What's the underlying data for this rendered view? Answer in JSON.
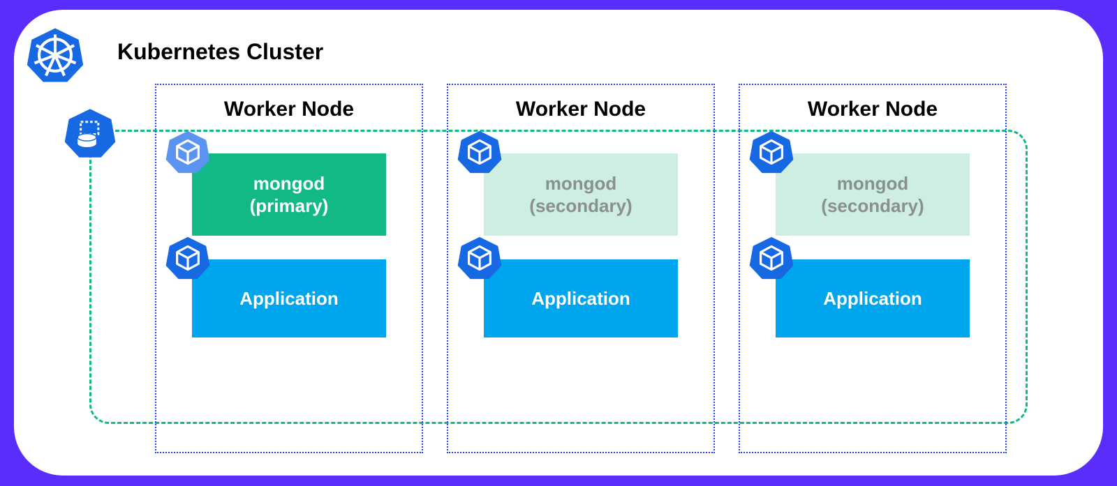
{
  "cluster": {
    "title": "Kubernetes Cluster"
  },
  "icons": {
    "wheel": "k8s-wheel-icon",
    "rs": "replicaset-icon",
    "cube": "cube-icon"
  },
  "nodes": [
    {
      "title": "Worker Node",
      "mongod": {
        "label1": "mongod",
        "label2": "(primary)",
        "style": "primary"
      },
      "app": {
        "label": "Application"
      }
    },
    {
      "title": "Worker Node",
      "mongod": {
        "label1": "mongod",
        "label2": "(secondary)",
        "style": "secondary"
      },
      "app": {
        "label": "Application"
      }
    },
    {
      "title": "Worker Node",
      "mongod": {
        "label1": "mongod",
        "label2": "(secondary)",
        "style": "secondary"
      },
      "app": {
        "label": "Application"
      }
    }
  ],
  "colors": {
    "frame": "#5b2dfd",
    "primary": "#12b886",
    "secondaryBg": "#cdeee0",
    "secondaryText": "#8a9090",
    "app": "#00a6ed",
    "nodeBorder": "#2a3df7",
    "hept": "#1668e3"
  }
}
